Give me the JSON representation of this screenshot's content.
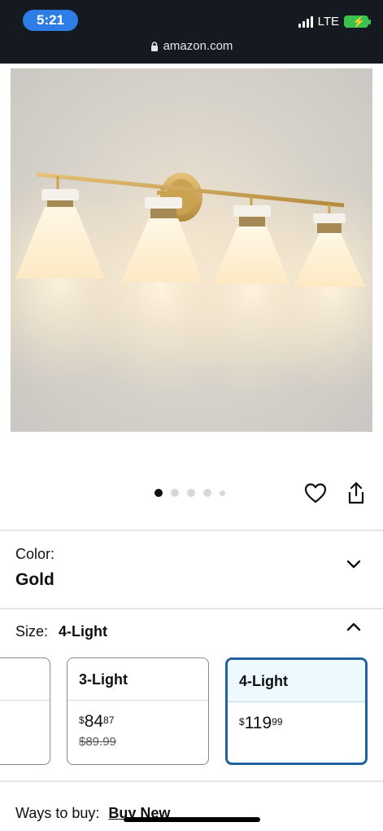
{
  "status_bar": {
    "time": "5:21",
    "network": "LTE",
    "battery_icon": "battery-charging-icon"
  },
  "browser": {
    "url": "amazon.com",
    "lock_icon": "lock-icon"
  },
  "gallery": {
    "image_alt": "vanity-light-fixture-image",
    "dots_count": 5,
    "active_index": 0,
    "favorite_icon": "heart-icon",
    "share_icon": "share-icon"
  },
  "color": {
    "label": "Color:",
    "value": "Gold",
    "expand_icon": "chevron-down-icon"
  },
  "size": {
    "label": "Size:",
    "value": "4-Light",
    "collapse_icon": "chevron-up-icon",
    "options": [
      {
        "name": "",
        "price_whole": "",
        "price_fraction": ""
      },
      {
        "name": "3-Light",
        "price_symbol": "$",
        "price_whole": "84",
        "price_fraction": "87",
        "list_price": "$89.99"
      },
      {
        "name": "4-Light",
        "price_symbol": "$",
        "price_whole": "119",
        "price_fraction": "99",
        "selected": true
      }
    ]
  },
  "buy": {
    "label": "Ways to buy:",
    "option": "Buy New"
  },
  "colors": {
    "accent": "#2162a1",
    "time_pill": "#2e7ce6",
    "battery": "#3ac24f"
  }
}
